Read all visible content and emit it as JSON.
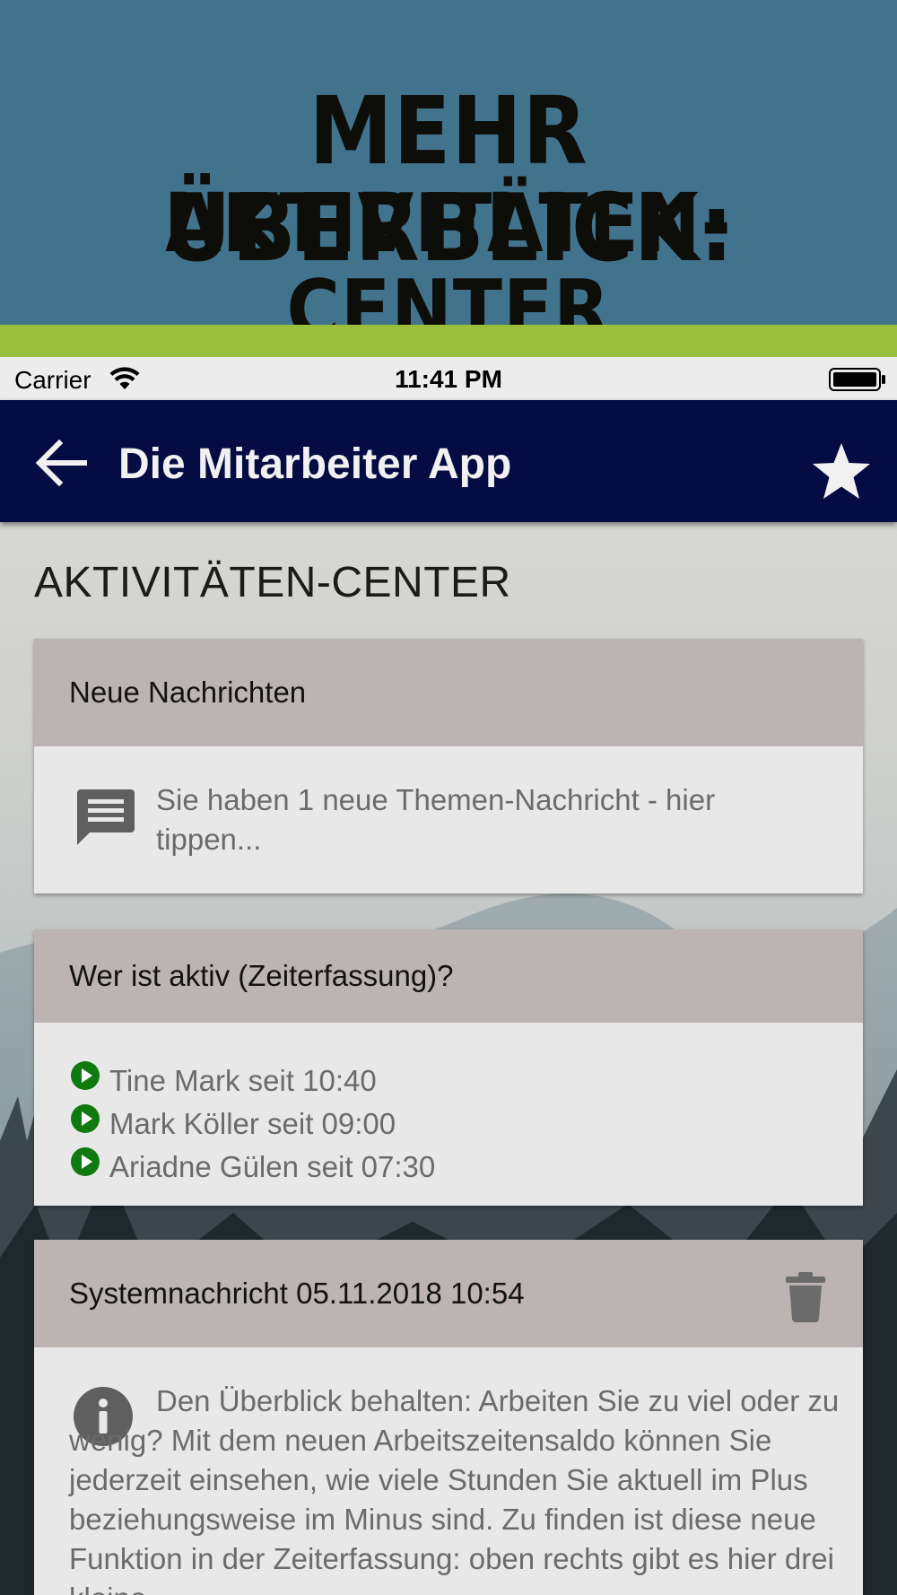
{
  "banner": {
    "line1": "MEHR ÜBERBLICK:",
    "line2": "AKTIVITÄTEN-CENTER",
    "background": "#42738c",
    "accent_bar": "#9bbf3b"
  },
  "statusbar": {
    "carrier": "Carrier",
    "time": "11:41 PM"
  },
  "navbar": {
    "title": "Die Mitarbeiter App",
    "background": "#050b43"
  },
  "page": {
    "heading": "AKTIVITÄTEN-CENTER"
  },
  "cards": {
    "messages": {
      "header": "Neue Nachrichten",
      "text": "Sie haben 1 neue Themen-Nachricht - hier tippen..."
    },
    "active": {
      "header": "Wer ist aktiv (Zeiterfassung)?",
      "items": [
        "Tine Mark seit 10:40",
        "Mark Köller seit 09:00",
        "Ariadne Gülen seit 07:30"
      ]
    },
    "system": {
      "header": "Systemnachricht 05.11.2018 10:54",
      "text": "Den Überblick behalten: Arbeiten Sie zu viel oder zu wenig? Mit dem neuen Arbeitszeitensaldo können Sie jederzeit einsehen, wie viele Stunden Sie aktuell im Plus beziehungsweise im Minus sind. Zu finden ist diese neue Funktion in der Zeiterfassung: oben rechts gibt es hier drei kleine"
    }
  },
  "colors": {
    "card_header": "#bcb4b3",
    "card_body": "#e8e8e8",
    "active_indicator": "#0f7a0f"
  }
}
